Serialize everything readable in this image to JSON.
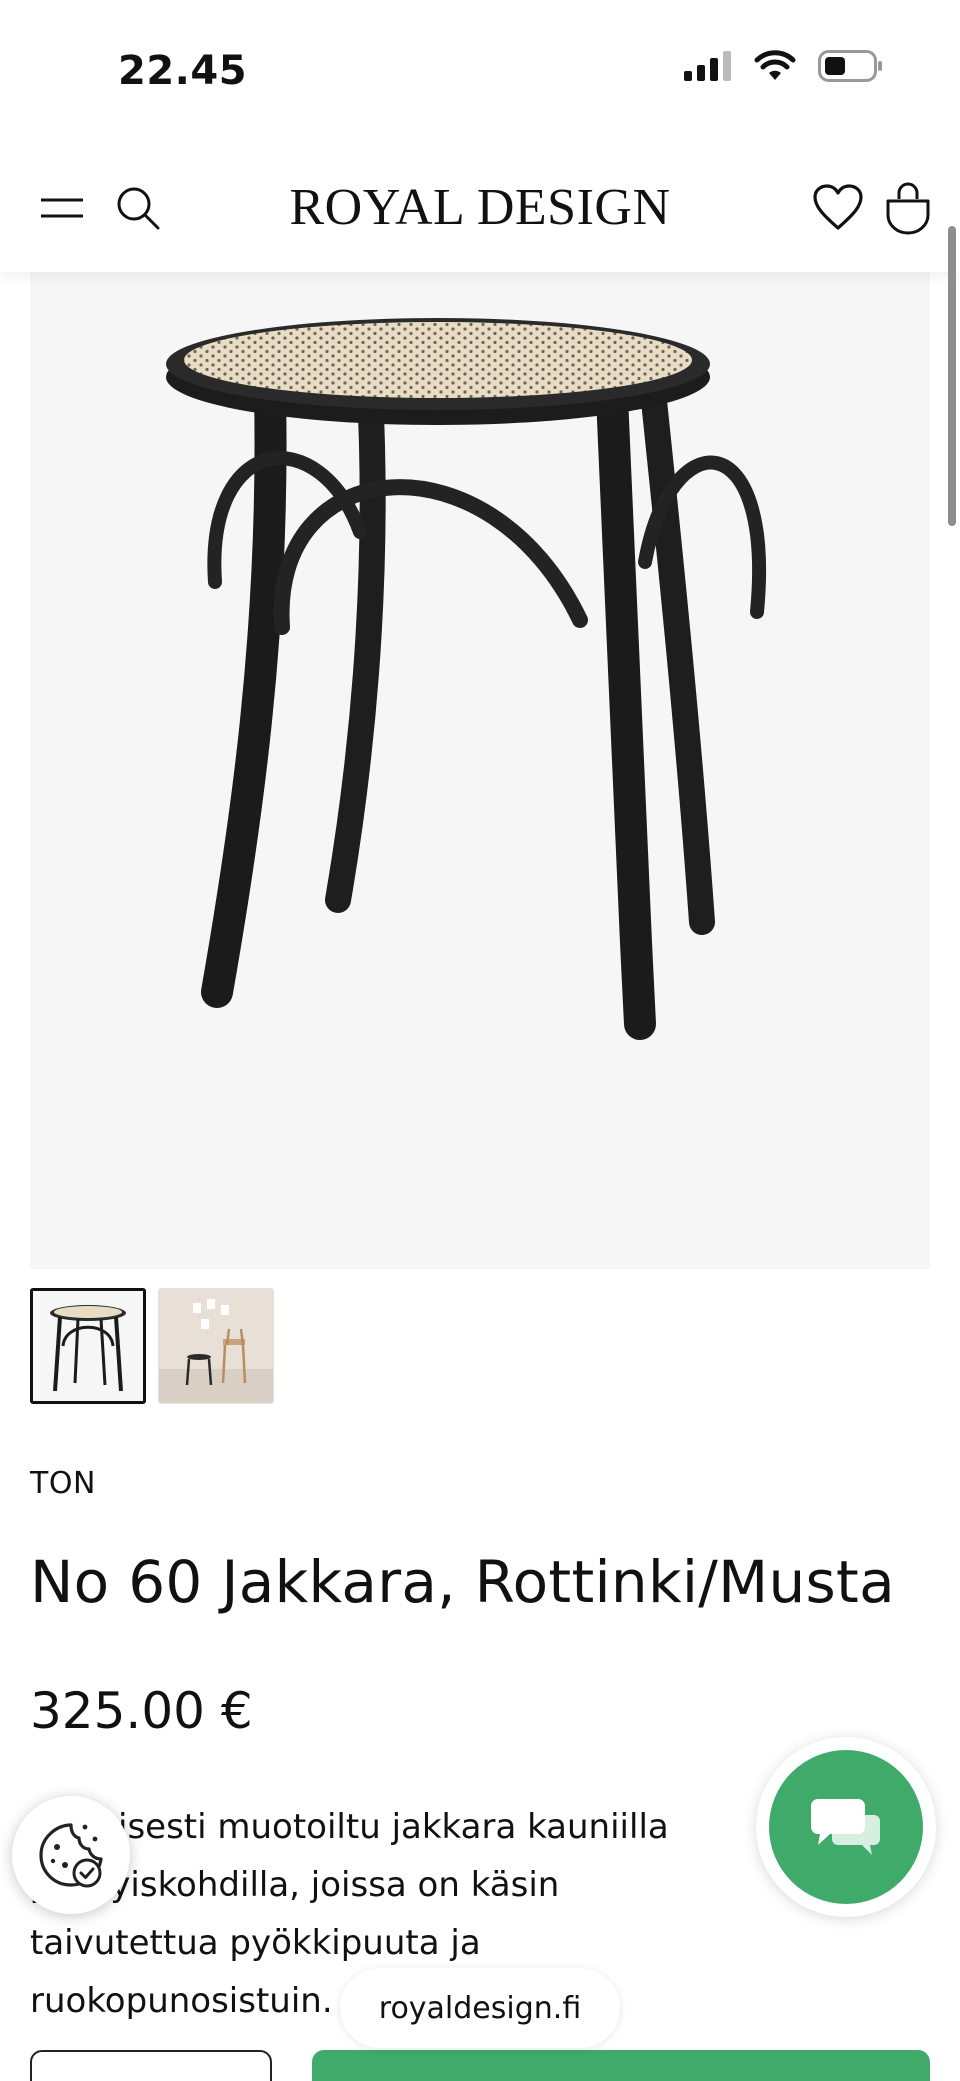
{
  "status_bar": {
    "time": "22.45",
    "icons": [
      "cellular-signal-icon",
      "wifi-icon",
      "battery-icon"
    ]
  },
  "header": {
    "logo": "ROYAL DESIGN",
    "icons": [
      "hamburger-menu-icon",
      "search-icon",
      "heart-icon",
      "shopping-bag-icon"
    ]
  },
  "product": {
    "brand": "TON",
    "title": "No 60 Jakkara, Rottinki/Musta",
    "price": "325.00 €",
    "description": "Klassisesti muotoiltu jakkara kauniilla yksityiskohdilla, joissa on käsin taivutettua pyökkipuuta ja ruokopunosistuin.",
    "images": [
      "stool-product-image",
      "stool-lifestyle-image"
    ],
    "selected_image": 1
  },
  "floating": {
    "cookie_icon": "cookie-settings-icon",
    "chat_icon": "chat-icon"
  },
  "browser": {
    "url": "royaldesign.fi"
  },
  "colors": {
    "accent": "#3faa6a",
    "text": "#111111",
    "image_bg": "#f6f6f6"
  }
}
